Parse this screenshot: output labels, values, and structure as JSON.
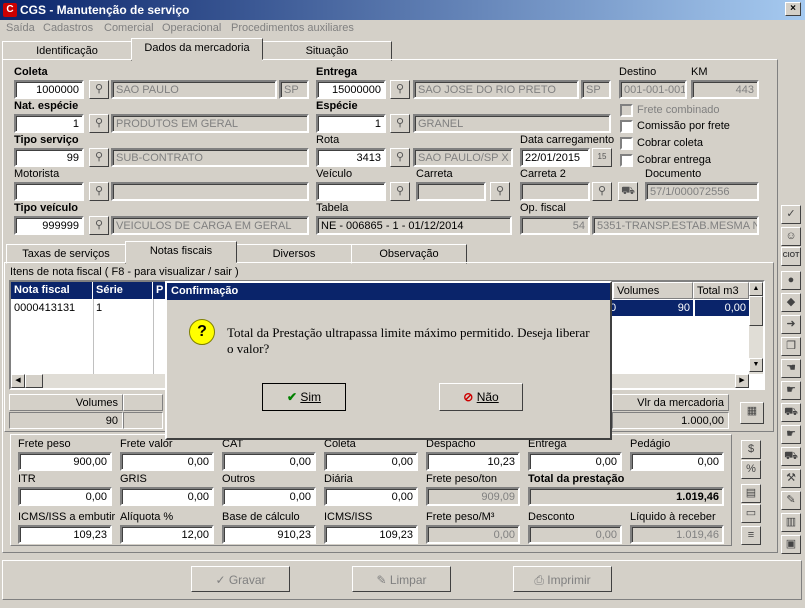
{
  "window": {
    "title": "CGS - Manutenção de serviço",
    "app_icon": "cgs-app-icon",
    "close_glyph": "×"
  },
  "menu": [
    "Saída",
    "Cadastros",
    "Comercial",
    "Operacional",
    "Procedimentos auxiliares"
  ],
  "tabs": [
    "Identificação",
    "Dados da mercadoria",
    "Situação"
  ],
  "form": {
    "coleta": {
      "label": "Coleta",
      "code": "1000000",
      "city": "SAO PAULO",
      "uf": "SP"
    },
    "entrega": {
      "label": "Entrega",
      "code": "15000000",
      "city": "SAO JOSE DO RIO PRETO",
      "uf": "SP"
    },
    "destino": {
      "label": "Destino",
      "value": "001-001-001"
    },
    "km": {
      "label": "KM",
      "value": "443"
    },
    "nat_especie": {
      "label": "Nat. espécie",
      "code": "1",
      "desc": "PRODUTOS EM GERAL"
    },
    "especie": {
      "label": "Espécie",
      "code": "1",
      "desc": "GRANEL"
    },
    "checks": [
      "Frete combinado",
      "Comissão por frete",
      "Cobrar coleta",
      "Cobrar entrega"
    ],
    "tipo_servico": {
      "label": "Tipo serviço",
      "code": "99",
      "desc": "SUB-CONTRATO"
    },
    "rota": {
      "label": "Rota",
      "code": "3413",
      "desc": "SAO PAULO/SP X"
    },
    "data_carregamento": {
      "label": "Data carregamento",
      "value": "22/01/2015"
    },
    "motorista": {
      "label": "Motorista",
      "code": "",
      "desc": ""
    },
    "veiculo": {
      "label": "Veículo",
      "value": ""
    },
    "carreta": {
      "label": "Carreta",
      "value": ""
    },
    "carreta2": {
      "label": "Carreta 2",
      "value": ""
    },
    "documento": {
      "label": "Documento",
      "value": "57/1/000072556"
    },
    "tipo_veiculo": {
      "label": "Tipo veículo",
      "code": "999999",
      "desc": "VEICULOS DE CARGA EM GERAL"
    },
    "tabela": {
      "label": "Tabela",
      "value": "NE - 006865 - 1 - 01/12/2014"
    },
    "op_fiscal": {
      "label": "Op. fiscal",
      "code": "54",
      "desc": "5351-TRANSP.ESTAB.MESMA N"
    }
  },
  "subtabs": [
    "Taxas de serviços",
    "Notas fiscais",
    "Diversos",
    "Observação"
  ],
  "nf": {
    "group_label": "Itens de nota fiscal ( F8 - para visualizar / sair )",
    "columns": [
      "Nota fiscal",
      "Série",
      "P",
      "Volumes",
      "Total m3"
    ],
    "rows": [
      {
        "nota": "0000413131",
        "serie": "1",
        "partial": "0",
        "volumes": "90",
        "total_m3": "0,00"
      }
    ],
    "summary": {
      "volumes_label": "Volumes",
      "volumes_value": "90",
      "vlr_label": "Vlr da mercadoria",
      "vlr_value": "1.000,00"
    }
  },
  "totals": {
    "row1": [
      {
        "label": "Frete peso",
        "value": "900,00"
      },
      {
        "label": "Frete valor",
        "value": "0,00"
      },
      {
        "label": "CAT",
        "value": "0,00"
      },
      {
        "label": "Coleta",
        "value": "0,00"
      },
      {
        "label": "Despacho",
        "value": "10,23"
      },
      {
        "label": "Entrega",
        "value": "0,00"
      },
      {
        "label": "Pedágio",
        "value": "0,00"
      }
    ],
    "row2": [
      {
        "label": "ITR",
        "value": "0,00"
      },
      {
        "label": "GRIS",
        "value": "0,00"
      },
      {
        "label": "Outros",
        "value": "0,00"
      },
      {
        "label": "Diária",
        "value": "0,00"
      },
      {
        "label": "Frete peso/ton",
        "value": "909,09"
      }
    ],
    "total_prestacao": {
      "label": "Total da prestação",
      "value": "1.019,46"
    },
    "row3": [
      {
        "label": "ICMS/ISS a embutir",
        "value": "109,23"
      },
      {
        "label": "Alíquota %",
        "value": "12,00"
      },
      {
        "label": "Base de cálculo",
        "value": "910,23"
      },
      {
        "label": "ICMS/ISS",
        "value": "109,23"
      },
      {
        "label": "Frete peso/M³",
        "value": "0,00"
      },
      {
        "label": "Desconto",
        "value": "0,00"
      },
      {
        "label": "Líquido à receber",
        "value": "1.019,46"
      }
    ]
  },
  "bottom_buttons": {
    "gravar": "Gravar",
    "limpar": "Limpar",
    "imprimir": "Imprimir"
  },
  "side_icons": [
    "check-icon",
    "users-icon",
    "ciot-icon",
    "circle-icon",
    "eraser-icon",
    "arrow-right-icon",
    "copy-icon",
    "hand-icon",
    "hand-point-icon",
    "truck-icon",
    "tool-icon",
    "edit-icon",
    "book-icon",
    "box-icon",
    "tag-icon"
  ],
  "side_ciot": "CIOT",
  "dialog": {
    "title": "Confirmação",
    "message": "Total da Prestação ultrapassa limite máximo permitido. Deseja liberar o valor?",
    "yes": "Sim",
    "no": "Não"
  },
  "colors": {
    "titlebar": "#0a246a",
    "face": "#d4d0c8",
    "selection": "#0a246a"
  }
}
